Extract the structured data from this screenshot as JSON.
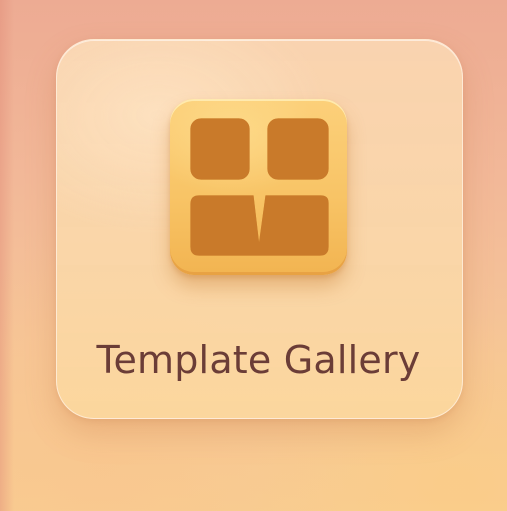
{
  "app": {
    "name": "Template Gallery",
    "icon": "template-grid-icon"
  },
  "colors": {
    "background_top": "#edab93",
    "background_bottom": "#f8cd92",
    "card": "#f9d6ae",
    "icon_light": "#fcd07a",
    "icon_dark": "#f2b451",
    "title_text": "#6b3d37"
  }
}
